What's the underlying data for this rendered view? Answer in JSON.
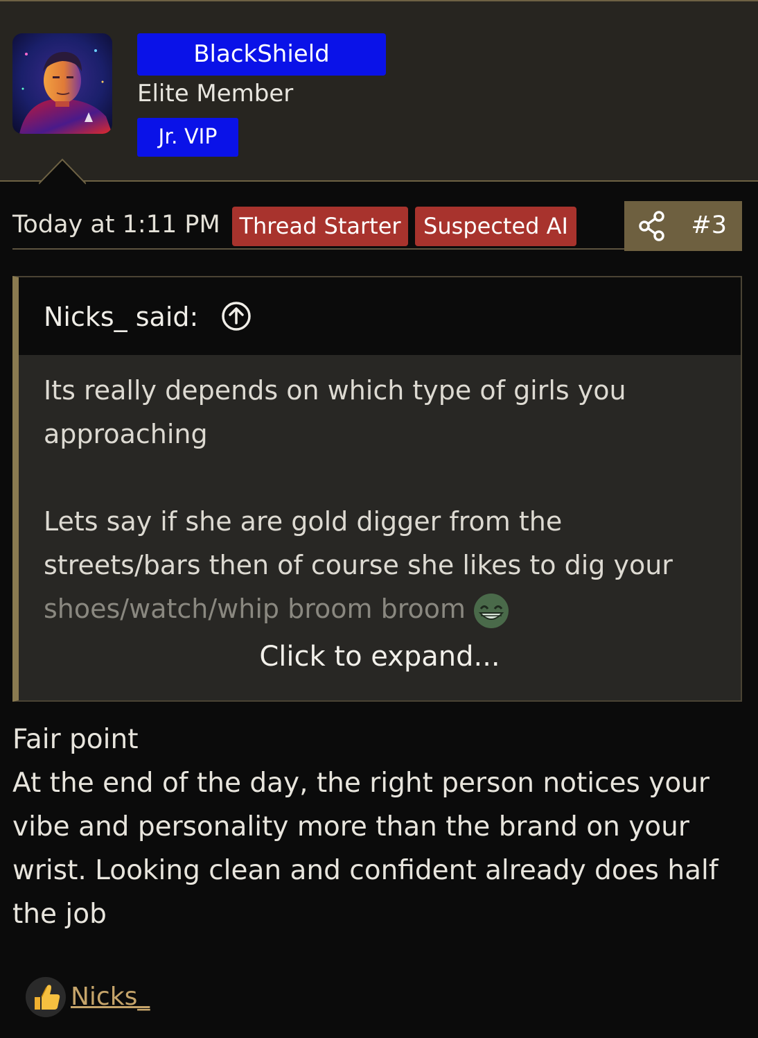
{
  "user": {
    "name": "BlackShield",
    "title": "Elite Member",
    "badge": "Jr. VIP",
    "avatar_icon": "user-avatar"
  },
  "post": {
    "time": "Today at 1:11 PM",
    "labels": [
      "Thread Starter",
      "Suspected AI"
    ],
    "number": "#3",
    "share_icon": "share-icon"
  },
  "quote": {
    "author_line": "Nicks_ said:",
    "paragraph1": "Its really depends on which type of girls you approaching",
    "paragraph2": "Lets say if she are gold digger from the streets/bars then of course she likes to dig your",
    "paragraph2_faded": "shoes/watch/whip broom broom",
    "emoji": "grinning-face",
    "expand": "Click to expand..."
  },
  "message": {
    "lines": [
      "Fair point",
      "At the end of the day, the right person notices your vibe and personality more than the brand on your wrist. Looking clean and confident already does half the job"
    ]
  },
  "reactions": {
    "icon": "thumbs-up-icon",
    "user": "Nicks_"
  },
  "colors": {
    "background": "#0b0b0b",
    "header_bg": "#272520",
    "username_bg": "#0a12e8",
    "label_red": "#a8332d",
    "accent_gold": "#8a7a50",
    "link": "#c5a46a"
  }
}
